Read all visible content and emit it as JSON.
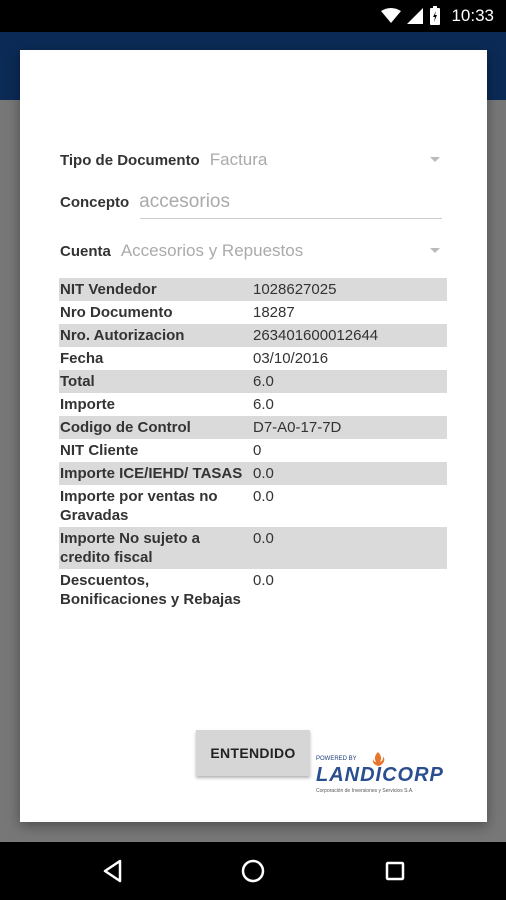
{
  "status_bar": {
    "time": "10:33",
    "icons": [
      "wifi-icon",
      "signal-icon",
      "battery-icon"
    ]
  },
  "dialog": {
    "tipo": {
      "label": "Tipo de Documento",
      "value": "Factura"
    },
    "concepto": {
      "label": "Concepto",
      "value": "accesorios"
    },
    "cuenta": {
      "label": "Cuenta",
      "value": "Accesorios y Repuestos"
    },
    "rows": [
      {
        "key": "NIT Vendedor",
        "value": "1028627025"
      },
      {
        "key": "Nro Documento",
        "value": "18287"
      },
      {
        "key": "Nro. Autorizacion",
        "value": "263401600012644"
      },
      {
        "key": "Fecha",
        "value": "03/10/2016"
      },
      {
        "key": "Total",
        "value": "6.0"
      },
      {
        "key": "Importe",
        "value": "6.0"
      },
      {
        "key": "Codigo de Control",
        "value": "D7-A0-17-7D"
      },
      {
        "key": "NIT Cliente",
        "value": "0"
      },
      {
        "key": "Importe ICE/IEHD/ TASAS",
        "value": "0.0"
      },
      {
        "key": "Importe por ventas no Gravadas",
        "value": "0.0"
      },
      {
        "key": "Importe No sujeto a credito fiscal",
        "value": "0.0"
      },
      {
        "key": "Descuentos, Bonificaciones y Rebajas",
        "value": "0.0"
      }
    ],
    "ok_label": "ENTENDIDO",
    "logo": {
      "powered_by": "POWERED BY",
      "brand": "LANDICORP",
      "subtitle": "Corporación de Inversiones y Servicios S.A."
    }
  },
  "colors": {
    "app_bar": "#0b2a55",
    "row_shade": "#dadada",
    "brand": "#2a4e8f"
  }
}
